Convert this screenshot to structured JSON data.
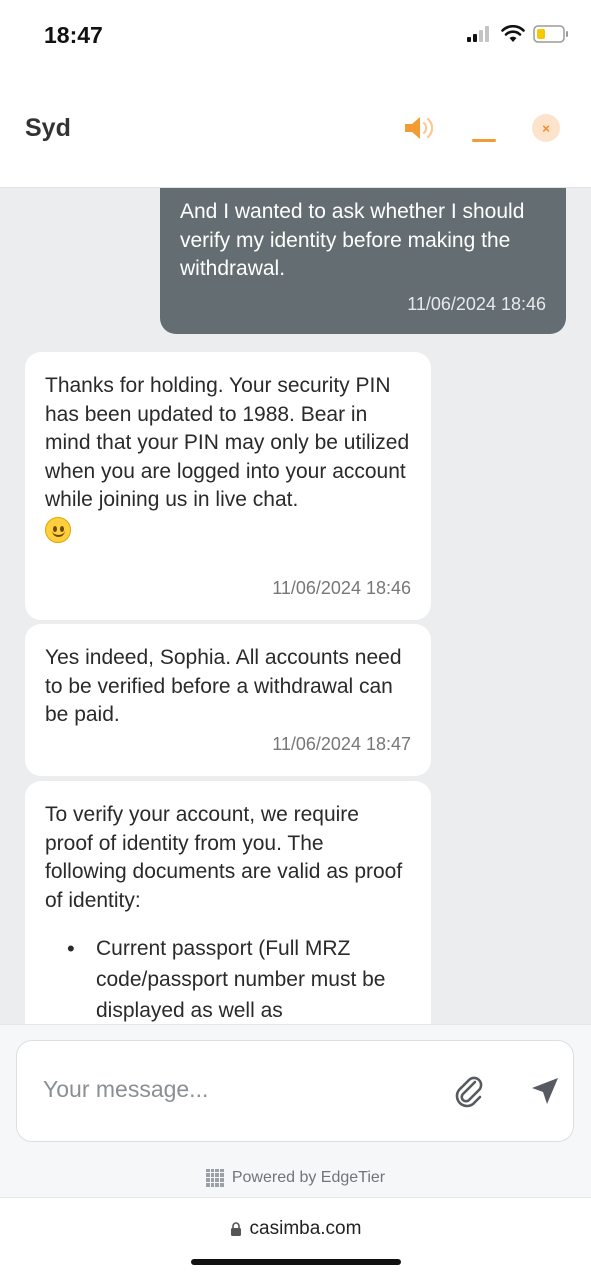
{
  "status_bar": {
    "time": "18:47"
  },
  "header": {
    "agent_name": "Syd",
    "icons": [
      "speaker-icon",
      "minimize-icon",
      "close-icon"
    ],
    "close_symbol": "×",
    "accent_color": "#f39c33"
  },
  "messages": [
    {
      "sender": "user",
      "text": "And I wanted to ask whether I should verify my identity before making the withdrawal.",
      "timestamp": "11/06/2024 18:46"
    },
    {
      "sender": "agent",
      "text": "Thanks for holding. Your security PIN has been updated to 1988. Bear in mind that your PIN may only be utilized when you are logged into your account while joining us in live chat.",
      "emoji": "slightly-smiling-face-icon",
      "timestamp": "11/06/2024 18:46"
    },
    {
      "sender": "agent",
      "text": "Yes indeed, Sophia. All accounts need to be verified before a withdrawal can be paid.",
      "timestamp": "11/06/2024 18:47"
    },
    {
      "sender": "agent",
      "text": "To verify your account, we require proof of identity from you. The following documents are valid as proof of identity:",
      "list_items": [
        "Current passport (Full MRZ code/passport number must be displayed as well as"
      ]
    }
  ],
  "composer": {
    "placeholder": "Your message...",
    "value": ""
  },
  "footer": {
    "powered_by": "Powered by EdgeTier"
  },
  "browser": {
    "url": "casimba.com"
  }
}
